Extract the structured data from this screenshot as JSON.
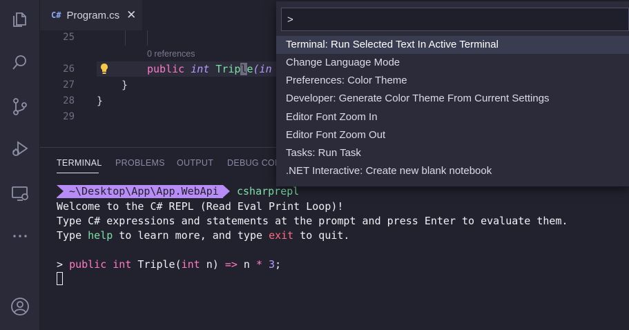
{
  "editor": {
    "tab": {
      "label": "Program.cs",
      "icon": "csharp-file-icon",
      "close": "✕"
    },
    "line_numbers": [
      "25",
      "26",
      "27",
      "28",
      "29"
    ],
    "codelens": "0 references",
    "line26": {
      "kw1": "public",
      "ty": "int",
      "fn_a": "Trip",
      "fn_cursor": "l",
      "fn_b": "e",
      "rest": "(in"
    },
    "line27": "}",
    "line28": "}"
  },
  "panel": {
    "tabs": [
      "TERMINAL",
      "PROBLEMS",
      "OUTPUT",
      "DEBUG CON"
    ],
    "active_tab": "TERMINAL"
  },
  "terminal": {
    "prompt_path": "~\\Desktop\\App\\App.WebApi",
    "command": "csharprepl",
    "welcome": "Welcome to the C# REPL (Read Eval Print Loop)!",
    "line2": "Type C# expressions and statements at the prompt and press Enter to evaluate them.",
    "line3_a": "Type ",
    "line3_help": "help",
    "line3_b": " to learn more, and type ",
    "line3_exit": "exit",
    "line3_c": " to quit.",
    "repl_prompt": "> ",
    "repl_kw": "public",
    "repl_ty": "int",
    "repl_fn": " Triple(",
    "repl_ty2": "int",
    "repl_mid": " n) ",
    "repl_arrow": "=>",
    "repl_n": " n ",
    "repl_star": "*",
    "repl_three": " 3",
    "repl_end": ";"
  },
  "palette": {
    "input_value": ">",
    "items": [
      "Terminal: Run Selected Text In Active Terminal",
      "Change Language Mode",
      "Preferences: Color Theme",
      "Developer: Generate Color Theme From Current Settings",
      "Editor Font Zoom In",
      "Editor Font Zoom Out",
      "Tasks: Run Task",
      ".NET Interactive: Create new blank notebook"
    ],
    "selected_index": 0
  },
  "activity_bar": {
    "icons": [
      "explorer-icon",
      "search-icon",
      "source-control-icon",
      "run-debug-icon",
      "remote-explorer-icon",
      "more-icon",
      "accounts-icon"
    ]
  },
  "colors": {
    "background": "#22222e",
    "keyword": "#ff7ac6",
    "type": "#b89cff",
    "function": "#7ee0a5",
    "prompt_segment": "#b88cf6",
    "error": "#ff6b81"
  }
}
